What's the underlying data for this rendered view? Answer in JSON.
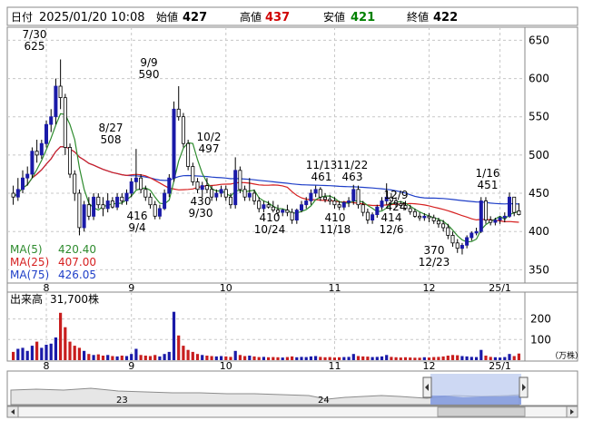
{
  "header": {
    "date_label": "日付",
    "datetime": "2025/01/20 10:08",
    "open_label": "始値",
    "open": "427",
    "high_label": "高値",
    "high": "437",
    "low_label": "安値",
    "low": "421",
    "close_label": "終値",
    "close": "422"
  },
  "legend": {
    "ma5": "MA(5)",
    "ma5_value": "420.40",
    "ma25": "MA(25)",
    "ma25_value": "407.00",
    "ma75": "MA(75)",
    "ma75_value": "426.05"
  },
  "volume_panel": {
    "title": "出来高",
    "value": "31,700株",
    "unit": "（万株）"
  },
  "navigator": {
    "year_labels": [
      "23",
      "24"
    ]
  },
  "colors": {
    "up": "#1a1aa8",
    "down": "#c81e1e",
    "ma5": "#2e8b2e",
    "ma25": "#d62020",
    "ma75": "#1f3fc8",
    "grid": "#c8c8c8",
    "high_text": "#d00000",
    "low_text": "#008000"
  },
  "chart_data": [
    {
      "type": "candlestick",
      "title": "",
      "x_tick_labels": [
        "8",
        "9",
        "10",
        "11",
        "12",
        "25/1"
      ],
      "y_ticks": [
        350,
        400,
        450,
        500,
        550,
        600,
        650
      ],
      "ylim": [
        335,
        660
      ],
      "grid": true,
      "annotations": [
        {
          "date": "7/30",
          "price": "625",
          "kind": "high"
        },
        {
          "date": "8/27",
          "price": "508",
          "kind": "high"
        },
        {
          "date": "9/9",
          "price": "590",
          "kind": "high"
        },
        {
          "date": "9/4",
          "price": "416",
          "kind": "low"
        },
        {
          "date": "10/2",
          "price": "497",
          "kind": "high"
        },
        {
          "date": "9/30",
          "price": "430",
          "kind": "low"
        },
        {
          "date": "10/24",
          "price": "410",
          "kind": "low"
        },
        {
          "date": "11/13",
          "price": "461",
          "kind": "high"
        },
        {
          "date": "11/18",
          "price": "410",
          "kind": "low"
        },
        {
          "date": "11/22",
          "price": "463",
          "kind": "high"
        },
        {
          "date": "12/9",
          "price": "424",
          "kind": "high"
        },
        {
          "date": "12/6",
          "price": "414",
          "kind": "low"
        },
        {
          "date": "12/23",
          "price": "370",
          "kind": "low"
        },
        {
          "date": "1/16",
          "price": "451",
          "kind": "high"
        }
      ],
      "ohlc": [
        [
          450,
          460,
          435,
          445
        ],
        [
          445,
          470,
          440,
          455
        ],
        [
          455,
          480,
          450,
          470
        ],
        [
          470,
          485,
          460,
          475
        ],
        [
          475,
          510,
          470,
          505
        ],
        [
          505,
          520,
          490,
          500
        ],
        [
          500,
          520,
          495,
          515
        ],
        [
          515,
          545,
          510,
          540
        ],
        [
          540,
          560,
          530,
          550
        ],
        [
          550,
          600,
          540,
          590
        ],
        [
          590,
          625,
          560,
          575
        ],
        [
          575,
          580,
          500,
          510
        ],
        [
          510,
          515,
          470,
          475
        ],
        [
          475,
          480,
          440,
          450
        ],
        [
          450,
          455,
          395,
          405
        ],
        [
          405,
          440,
          400,
          435
        ],
        [
          435,
          445,
          415,
          420
        ],
        [
          420,
          450,
          415,
          445
        ],
        [
          445,
          450,
          430,
          435
        ],
        [
          435,
          445,
          420,
          430
        ],
        [
          430,
          450,
          425,
          440
        ],
        [
          440,
          445,
          430,
          432
        ],
        [
          432,
          450,
          428,
          445
        ],
        [
          445,
          450,
          435,
          440
        ],
        [
          440,
          455,
          435,
          450
        ],
        [
          450,
          470,
          445,
          465
        ],
        [
          465,
          508,
          455,
          470
        ],
        [
          470,
          475,
          450,
          455
        ],
        [
          455,
          460,
          440,
          445
        ],
        [
          445,
          450,
          430,
          435
        ],
        [
          435,
          440,
          416,
          420
        ],
        [
          420,
          435,
          416,
          430
        ],
        [
          430,
          455,
          428,
          450
        ],
        [
          450,
          475,
          445,
          470
        ],
        [
          470,
          570,
          465,
          560
        ],
        [
          560,
          590,
          545,
          550
        ],
        [
          550,
          555,
          510,
          515
        ],
        [
          515,
          520,
          480,
          485
        ],
        [
          485,
          490,
          460,
          465
        ],
        [
          465,
          470,
          450,
          455
        ],
        [
          455,
          465,
          445,
          460
        ],
        [
          460,
          470,
          450,
          455
        ],
        [
          455,
          460,
          440,
          445
        ],
        [
          445,
          455,
          440,
          450
        ],
        [
          450,
          460,
          445,
          455
        ],
        [
          455,
          460,
          440,
          445
        ],
        [
          445,
          450,
          430,
          435
        ],
        [
          435,
          497,
          430,
          480
        ],
        [
          480,
          485,
          450,
          455
        ],
        [
          455,
          460,
          440,
          445
        ],
        [
          445,
          470,
          440,
          450
        ],
        [
          450,
          455,
          435,
          440
        ],
        [
          440,
          445,
          425,
          430
        ],
        [
          430,
          440,
          425,
          435
        ],
        [
          435,
          440,
          430,
          432
        ],
        [
          432,
          440,
          425,
          428
        ],
        [
          428,
          435,
          420,
          425
        ],
        [
          425,
          430,
          420,
          428
        ],
        [
          428,
          435,
          420,
          425
        ],
        [
          425,
          430,
          410,
          415
        ],
        [
          415,
          430,
          410,
          428
        ],
        [
          428,
          440,
          425,
          435
        ],
        [
          435,
          445,
          430,
          440
        ],
        [
          440,
          455,
          435,
          450
        ],
        [
          450,
          460,
          445,
          455
        ],
        [
          455,
          458,
          440,
          445
        ],
        [
          445,
          450,
          438,
          442
        ],
        [
          442,
          448,
          435,
          440
        ],
        [
          440,
          445,
          430,
          435
        ],
        [
          435,
          440,
          428,
          432
        ],
        [
          432,
          440,
          428,
          438
        ],
        [
          438,
          445,
          432,
          440
        ],
        [
          440,
          461,
          435,
          455
        ],
        [
          455,
          460,
          430,
          435
        ],
        [
          435,
          440,
          420,
          425
        ],
        [
          425,
          430,
          410,
          415
        ],
        [
          415,
          425,
          410,
          422
        ],
        [
          422,
          435,
          418,
          432
        ],
        [
          432,
          445,
          428,
          440
        ],
        [
          440,
          463,
          435,
          445
        ],
        [
          445,
          450,
          435,
          440
        ],
        [
          440,
          445,
          432,
          436
        ],
        [
          436,
          440,
          430,
          434
        ],
        [
          434,
          440,
          428,
          430
        ],
        [
          430,
          435,
          422,
          426
        ],
        [
          426,
          430,
          418,
          420
        ],
        [
          420,
          425,
          414,
          418
        ],
        [
          418,
          424,
          414,
          420
        ],
        [
          420,
          424,
          412,
          418
        ],
        [
          418,
          422,
          410,
          414
        ],
        [
          414,
          418,
          405,
          410
        ],
        [
          410,
          415,
          400,
          405
        ],
        [
          405,
          410,
          390,
          395
        ],
        [
          395,
          400,
          380,
          385
        ],
        [
          385,
          390,
          372,
          378
        ],
        [
          378,
          385,
          370,
          382
        ],
        [
          382,
          395,
          378,
          392
        ],
        [
          392,
          400,
          388,
          398
        ],
        [
          398,
          405,
          395,
          400
        ],
        [
          400,
          445,
          398,
          440
        ],
        [
          440,
          445,
          410,
          415
        ],
        [
          415,
          420,
          408,
          412
        ],
        [
          412,
          418,
          408,
          415
        ],
        [
          415,
          420,
          410,
          418
        ],
        [
          418,
          425,
          412,
          420
        ],
        [
          420,
          451,
          418,
          445
        ],
        [
          445,
          440,
          420,
          425
        ],
        [
          427,
          437,
          421,
          422
        ]
      ]
    },
    {
      "type": "bar",
      "title": "出来高",
      "y_ticks": [
        100,
        200
      ],
      "y_unit": "万株",
      "ylim": [
        0,
        260
      ],
      "values": [
        40,
        55,
        60,
        45,
        70,
        90,
        60,
        75,
        80,
        110,
        230,
        160,
        90,
        70,
        60,
        45,
        30,
        25,
        28,
        22,
        25,
        20,
        18,
        22,
        20,
        30,
        55,
        25,
        22,
        20,
        25,
        18,
        30,
        40,
        235,
        120,
        70,
        50,
        40,
        30,
        25,
        22,
        20,
        18,
        20,
        18,
        16,
        45,
        25,
        20,
        22,
        18,
        15,
        16,
        14,
        15,
        14,
        13,
        15,
        18,
        14,
        16,
        15,
        18,
        20,
        16,
        14,
        15,
        13,
        14,
        15,
        16,
        30,
        20,
        18,
        17,
        15,
        16,
        18,
        25,
        16,
        14,
        13,
        14,
        13,
        12,
        12,
        14,
        13,
        15,
        16,
        18,
        22,
        25,
        24,
        20,
        18,
        16,
        15,
        50,
        22,
        16,
        14,
        13,
        15,
        30,
        20,
        32
      ]
    }
  ]
}
